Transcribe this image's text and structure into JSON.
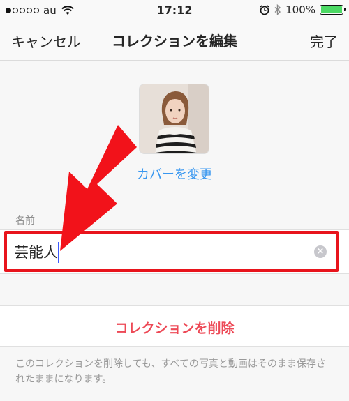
{
  "status_bar": {
    "carrier": "au",
    "time": "17:12",
    "battery_percent": "100%",
    "battery_level": 1.0,
    "signal_bars_filled": 1,
    "signal_bars_total": 5
  },
  "nav": {
    "cancel_label": "キャンセル",
    "title": "コレクションを編集",
    "done_label": "完了"
  },
  "cover": {
    "change_label": "カバーを変更"
  },
  "name_field": {
    "label": "名前",
    "value": "芸能人"
  },
  "delete": {
    "label": "コレクションを削除"
  },
  "footer": {
    "note": "このコレクションを削除しても、すべての写真と動画はそのまま保存されたままになります。"
  },
  "colors": {
    "accent_blue": "#3897f0",
    "delete_red": "#ed4956",
    "annotation_red": "#e8141c",
    "battery_green": "#4cd964"
  }
}
